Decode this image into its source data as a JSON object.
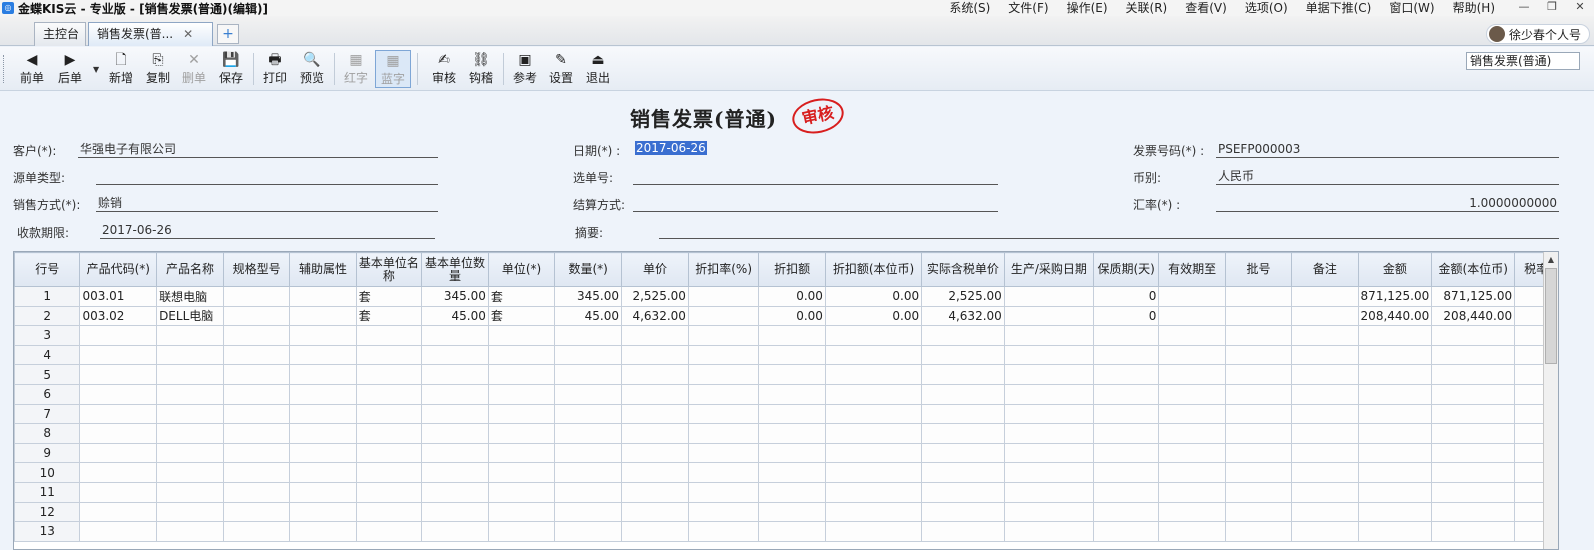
{
  "window": {
    "title": "金蝶KIS云 - 专业版 - [销售发票(普通)(编辑)]",
    "menus": [
      "系统(S)",
      "文件(F)",
      "操作(E)",
      "关联(R)",
      "查看(V)",
      "选项(O)",
      "单据下推(C)",
      "窗口(W)",
      "帮助(H)"
    ]
  },
  "tabs": {
    "main": "主控台",
    "active": "销售发票(普...",
    "close_glyph": "✕",
    "add_glyph": "+"
  },
  "user": {
    "name": "徐少春个人号"
  },
  "toolbar": {
    "prev": "前单",
    "next": "后单",
    "new": "新增",
    "copy": "复制",
    "delete": "删单",
    "save": "保存",
    "print": "打印",
    "preview": "预览",
    "red": "红字",
    "blue": "蓝字",
    "audit": "审核",
    "check": "钩稽",
    "reference": "参考",
    "settings": "设置",
    "exit": "退出",
    "form_type": "销售发票(普通)"
  },
  "form": {
    "title": "销售发票(普通)",
    "stamp": "审核",
    "customer_label": "客户(*):",
    "customer": "华强电子有限公司",
    "source_type_label": "源单类型:",
    "source_type": "",
    "sales_method_label": "销售方式(*):",
    "sales_method": "赊销",
    "due_date_label": "收款期限:",
    "due_date": "2017-06-26",
    "date_label": "日期(*) :",
    "date": "2017-06-26",
    "select_no_label": "选单号:",
    "select_no": "",
    "settlement_label": "结算方式:",
    "settlement": "",
    "summary_label": "摘要:",
    "summary": "",
    "invoice_no_label": "发票号码(*) :",
    "invoice_no": "PSEFP000003",
    "currency_label": "币别:",
    "currency": "人民币",
    "rate_label": "汇率(*) :",
    "rate": "1.0000000000"
  },
  "grid": {
    "headers": [
      "行号",
      "产品代码(*)",
      "产品名称",
      "规格型号",
      "辅助属性",
      "基本单位名称",
      "基本单位数量",
      "单位(*)",
      "数量(*)",
      "单价",
      "折扣率(%)",
      "折扣额",
      "折扣额(本位币)",
      "实际含税单价",
      "生产/采购日期",
      "保质期(天)",
      "有效期至",
      "批号",
      "备注",
      "金额",
      "金额(本位币)",
      "税率"
    ],
    "rows": [
      [
        "1",
        "003.01",
        "联想电脑",
        "",
        "",
        "套",
        "345.00",
        "套",
        "345.00",
        "2,525.00",
        "",
        "0.00",
        "0.00",
        "2,525.00",
        "",
        "0",
        "",
        "",
        "",
        "871,125.00",
        "871,125.00",
        ""
      ],
      [
        "2",
        "003.02",
        "DELL电脑",
        "",
        "",
        "套",
        "45.00",
        "套",
        "45.00",
        "4,632.00",
        "",
        "0.00",
        "0.00",
        "4,632.00",
        "",
        "0",
        "",
        "",
        "",
        "208,440.00",
        "208,440.00",
        ""
      ],
      [
        "3",
        "",
        "",
        "",
        "",
        "",
        "",
        "",
        "",
        "",
        "",
        "",
        "",
        "",
        "",
        "",
        "",
        "",
        "",
        "",
        "",
        ""
      ],
      [
        "4",
        "",
        "",
        "",
        "",
        "",
        "",
        "",
        "",
        "",
        "",
        "",
        "",
        "",
        "",
        "",
        "",
        "",
        "",
        "",
        "",
        ""
      ],
      [
        "5",
        "",
        "",
        "",
        "",
        "",
        "",
        "",
        "",
        "",
        "",
        "",
        "",
        "",
        "",
        "",
        "",
        "",
        "",
        "",
        "",
        ""
      ],
      [
        "6",
        "",
        "",
        "",
        "",
        "",
        "",
        "",
        "",
        "",
        "",
        "",
        "",
        "",
        "",
        "",
        "",
        "",
        "",
        "",
        "",
        ""
      ],
      [
        "7",
        "",
        "",
        "",
        "",
        "",
        "",
        "",
        "",
        "",
        "",
        "",
        "",
        "",
        "",
        "",
        "",
        "",
        "",
        "",
        "",
        ""
      ],
      [
        "8",
        "",
        "",
        "",
        "",
        "",
        "",
        "",
        "",
        "",
        "",
        "",
        "",
        "",
        "",
        "",
        "",
        "",
        "",
        "",
        "",
        ""
      ],
      [
        "9",
        "",
        "",
        "",
        "",
        "",
        "",
        "",
        "",
        "",
        "",
        "",
        "",
        "",
        "",
        "",
        "",
        "",
        "",
        "",
        "",
        ""
      ],
      [
        "10",
        "",
        "",
        "",
        "",
        "",
        "",
        "",
        "",
        "",
        "",
        "",
        "",
        "",
        "",
        "",
        "",
        "",
        "",
        "",
        "",
        ""
      ],
      [
        "11",
        "",
        "",
        "",
        "",
        "",
        "",
        "",
        "",
        "",
        "",
        "",
        "",
        "",
        "",
        "",
        "",
        "",
        "",
        "",
        "",
        ""
      ],
      [
        "12",
        "",
        "",
        "",
        "",
        "",
        "",
        "",
        "",
        "",
        "",
        "",
        "",
        "",
        "",
        "",
        "",
        "",
        "",
        "",
        "",
        ""
      ],
      [
        "13",
        "",
        "",
        "",
        "",
        "",
        "",
        "",
        "",
        "",
        "",
        "",
        "",
        "",
        "",
        "",
        "",
        "",
        "",
        "",
        "",
        ""
      ]
    ]
  }
}
